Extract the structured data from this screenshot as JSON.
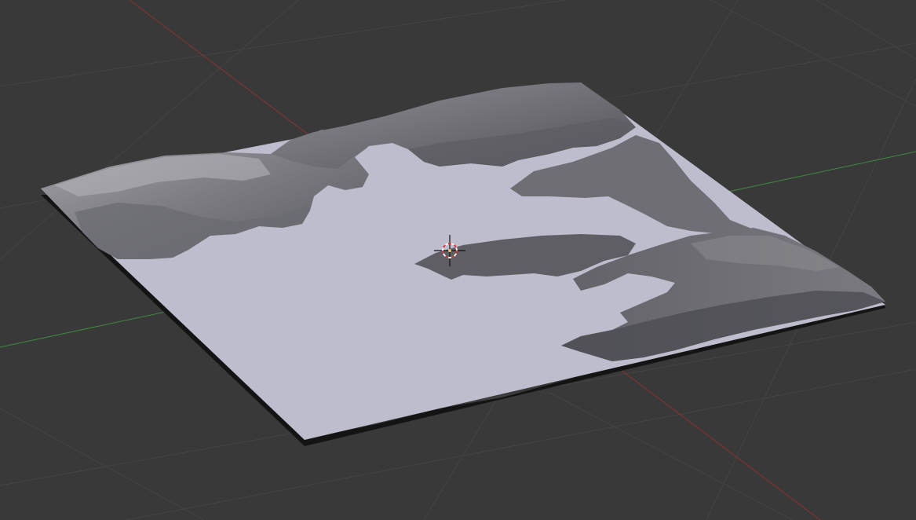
{
  "viewport": {
    "background": "#393939",
    "grid_color": "#444444",
    "x_axis_color": "#8a3434",
    "y_axis_color": "#3f8a3f"
  },
  "terrain": {
    "water_color": "#bdbdcd",
    "rock_light": "#9a9aa0",
    "rock_mid": "#76767c",
    "rock_dark": "#55555a",
    "edge_color": "#141414"
  },
  "cursor": {
    "icon": "3d-cursor-icon",
    "ring_color_a": "#d23a3a",
    "ring_color_b": "#f2f2f2"
  }
}
